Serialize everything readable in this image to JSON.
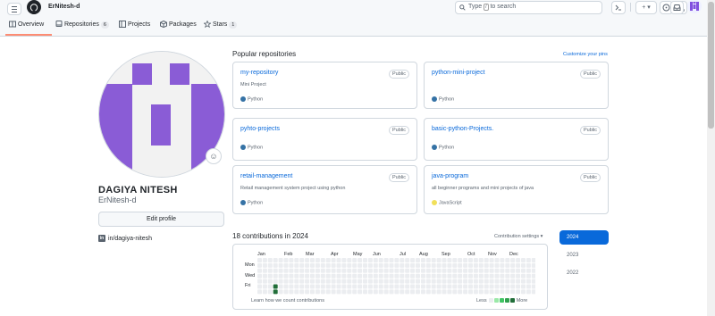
{
  "header": {
    "username": "ErNitesh-d",
    "search_prefix": "Type",
    "search_key": "/",
    "search_suffix": "to search",
    "plus_label": "+ ▾"
  },
  "tabs": [
    {
      "label": "Overview",
      "count": ""
    },
    {
      "label": "Repositories",
      "count": "6"
    },
    {
      "label": "Projects",
      "count": ""
    },
    {
      "label": "Packages",
      "count": ""
    },
    {
      "label": "Stars",
      "count": "1"
    }
  ],
  "profile": {
    "name": "DAGIYA NITESH",
    "login": "ErNitesh-d",
    "edit_label": "Edit profile",
    "linkedin": "in/dagiya-nitesh",
    "linkedin_icon": "in",
    "emoji_icon": "☺"
  },
  "popular": {
    "title": "Popular repositories",
    "customize": "Customize your pins",
    "repos": [
      {
        "name": "my-repository",
        "visibility": "Public",
        "description": "Mini Project",
        "language": "Python",
        "lang_color": "#3572A5"
      },
      {
        "name": "python-mini-project",
        "visibility": "Public",
        "description": "",
        "language": "Python",
        "lang_color": "#3572A5"
      },
      {
        "name": "pyhto-projects",
        "visibility": "Public",
        "description": "",
        "language": "Python",
        "lang_color": "#3572A5"
      },
      {
        "name": "basic-python-Projects.",
        "visibility": "Public",
        "description": "",
        "language": "Python",
        "lang_color": "#3572A5"
      },
      {
        "name": "retail-management",
        "visibility": "Public",
        "description": "Retail management system project using python",
        "language": "Python",
        "lang_color": "#3572A5"
      },
      {
        "name": "java-program",
        "visibility": "Public",
        "description": "all beginner programs and mini projects of java",
        "language": "JavaScript",
        "lang_color": "#f1e05a"
      }
    ]
  },
  "contributions": {
    "title": "18 contributions in 2024",
    "settings": "Contribution settings ▾",
    "months": [
      "Jan",
      "Feb",
      "Mar",
      "Apr",
      "May",
      "Jun",
      "Jul",
      "Aug",
      "Sep",
      "Oct",
      "Nov",
      "Dec"
    ],
    "days": [
      "Mon",
      "Wed",
      "Fri"
    ],
    "learn": "Learn how we count contributions",
    "less": "Less",
    "more": "More",
    "colors": {
      "empty": "#ebedf0",
      "l1": "#9be9a8",
      "l2": "#40c463",
      "l3": "#30a14e",
      "l4": "#216e39"
    },
    "active_cells": [
      {
        "week": 3,
        "day": 5,
        "level": 4
      },
      {
        "week": 3,
        "day": 6,
        "level": 4
      }
    ],
    "years": [
      "2024",
      "2023",
      "2022"
    ],
    "selected_year": "2024"
  }
}
